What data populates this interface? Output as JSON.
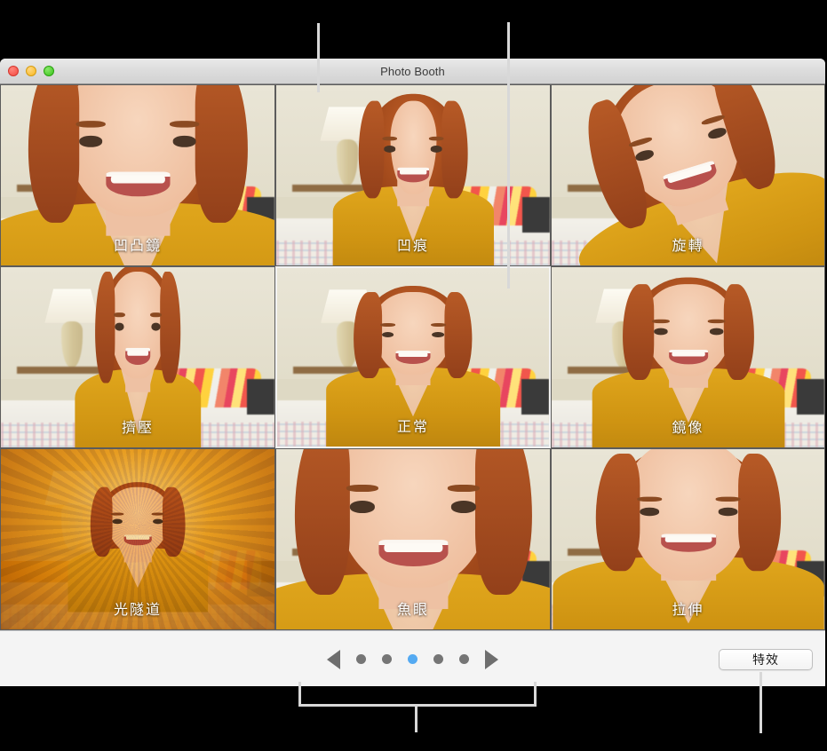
{
  "window": {
    "title": "Photo Booth",
    "traffic_lights": [
      {
        "name": "close",
        "color": "#f44a41"
      },
      {
        "name": "minimize",
        "color": "#f9b81e"
      },
      {
        "name": "maximize",
        "color": "#38c419"
      }
    ]
  },
  "effects_grid": {
    "columns": 3,
    "rows": 3,
    "selected_index": 4,
    "cells": [
      {
        "label": "凹凸鏡",
        "fx": "fx-bulge",
        "selected": false
      },
      {
        "label": "凹痕",
        "fx": "fx-dent",
        "selected": false
      },
      {
        "label": "旋轉",
        "fx": "fx-twirl",
        "selected": false
      },
      {
        "label": "擠壓",
        "fx": "fx-squeeze",
        "selected": false
      },
      {
        "label": "正常",
        "fx": "fx-normal",
        "selected": true
      },
      {
        "label": "鏡像",
        "fx": "fx-mirror",
        "selected": false
      },
      {
        "label": "光隧道",
        "fx": "fx-tunnel",
        "selected": false
      },
      {
        "label": "魚眼",
        "fx": "fx-fisheye",
        "selected": false
      },
      {
        "label": "拉伸",
        "fx": "fx-stretch",
        "selected": false
      }
    ]
  },
  "toolbar": {
    "prev_arrow": "◀",
    "next_arrow": "▶",
    "pages": 5,
    "active_page": 3,
    "effects_button_label": "特效",
    "active_dot_color": "#54aaf2",
    "inactive_dot_color": "#757575"
  },
  "callouts": {
    "line_left": "",
    "line_right": "",
    "bracket": "",
    "line_effects": ""
  }
}
